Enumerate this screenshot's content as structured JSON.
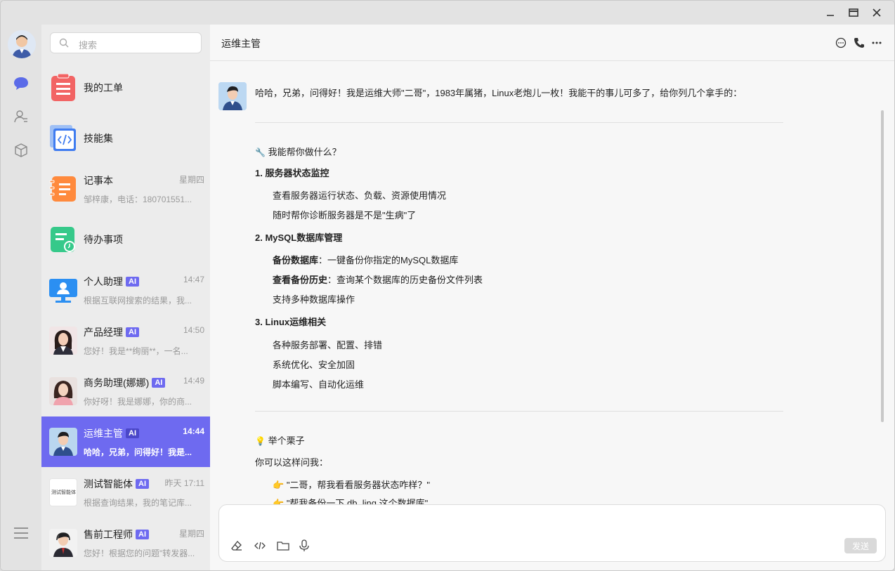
{
  "window": {
    "controls": [
      "minimize-icon",
      "maximize-icon",
      "close-icon"
    ]
  },
  "rail": {
    "icons": [
      "chat-icon",
      "contacts-icon",
      "box-icon"
    ],
    "menu_icon": "menu-icon"
  },
  "search": {
    "placeholder": "搜索"
  },
  "conversations": [
    {
      "name": "我的工单",
      "ai": false,
      "time": "",
      "preview": ""
    },
    {
      "name": "技能集",
      "ai": false,
      "time": "",
      "preview": ""
    },
    {
      "name": "记事本",
      "ai": false,
      "time": "星期四",
      "preview": "邹梓康，电话：180701551..."
    },
    {
      "name": "待办事项",
      "ai": false,
      "time": "",
      "preview": ""
    },
    {
      "name": "个人助理",
      "ai": true,
      "ai_label": "AI",
      "time": "14:47",
      "preview": "根据互联网搜索的结果，我..."
    },
    {
      "name": "产品经理",
      "ai": true,
      "ai_label": "AI",
      "time": "14:50",
      "preview": "您好！我是**绚丽**，一名..."
    },
    {
      "name": "商务助理(娜娜)",
      "ai": true,
      "ai_label": "AI",
      "time": "14:49",
      "preview": "你好呀！我是娜娜，你的商..."
    },
    {
      "name": "运维主管",
      "ai": true,
      "ai_label": "AI",
      "time": "14:44",
      "preview": "哈哈，兄弟，问得好！我是...",
      "active": true
    },
    {
      "name": "测试智能体",
      "ai": true,
      "ai_label": "AI",
      "time": "昨天 17:11",
      "preview": "根据查询结果，我的笔记库...",
      "icon_text": "测试智能体"
    },
    {
      "name": "售前工程师",
      "ai": true,
      "ai_label": "AI",
      "time": "星期四",
      "preview": "您好！根据您的问题\"转发器..."
    }
  ],
  "chat": {
    "title": "运维主管",
    "intro": "哈哈，兄弟，问得好！我是运维大师\"二哥\"，1983年属猪，Linux老炮儿一枚！我能干的事儿可多了，给你列几个拿手的：",
    "section_help": "我能帮你做什么？",
    "h1": "1. 服务器状态监控",
    "h1_items": [
      "查看服务器运行状态、负载、资源使用情况",
      "随时帮你诊断服务器是不是\"生病\"了"
    ],
    "h2": "2. MySQL数据库管理",
    "h2_b1": "备份数据库",
    "h2_t1": "：一键备份你指定的MySQL数据库",
    "h2_b2": "查看备份历史",
    "h2_t2": "：查询某个数据库的历史备份文件列表",
    "h2_t3": "支持多种数据库操作",
    "h3": "3. Linux运维相关",
    "h3_items": [
      "各种服务部署、配置、排错",
      "系统优化、安全加固",
      "脚本编写、自动化运维"
    ],
    "example_title": "举个栗子",
    "example_lead": "你可以这样问我：",
    "examples": [
      "\"二哥，帮我看看服务器状态咋样？\"",
      "\"帮我备份一下 db_ling 这个数据库\""
    ]
  },
  "composer": {
    "send_label": "发送",
    "tools": [
      "eraser-icon",
      "code-icon",
      "folder-icon",
      "mic-icon"
    ]
  },
  "colors": {
    "accent": "#6e6af0"
  }
}
